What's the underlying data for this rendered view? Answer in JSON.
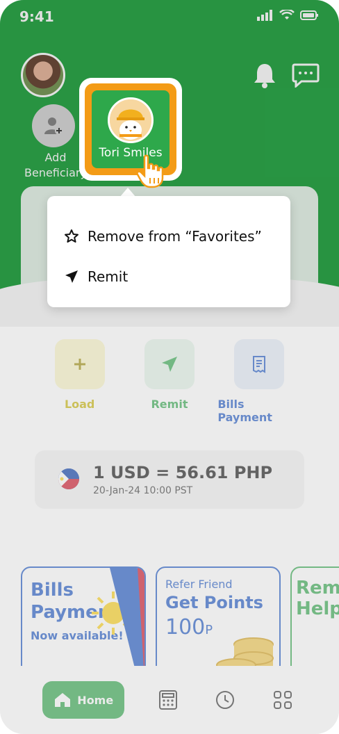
{
  "status": {
    "time": "9:41"
  },
  "header": {
    "add_beneficiary_label": "Add Beneficiary",
    "favorite_name": "Tori Smiles"
  },
  "context_menu": {
    "remove_favorite": "Remove from “Favorites”",
    "remit": "Remit"
  },
  "services": [
    {
      "label": "Load",
      "color": "#c9b400"
    },
    {
      "label": "Remit",
      "color": "#2ea84b"
    },
    {
      "label": "Bills Payment",
      "color": "#1a56c4"
    }
  ],
  "exchange_rate": {
    "main": "1 USD = 56.61 PHP",
    "timestamp": "20-Jan-24 10:00 PST"
  },
  "banners": {
    "bills": {
      "line1": "Bills",
      "line2": "Payment",
      "line3": "Now available!"
    },
    "refer": {
      "line1": "Refer Friend",
      "line2": "Get Points",
      "line3": "100",
      "unit": "P"
    },
    "remit": {
      "line1": "Rem",
      "line2": "Help"
    }
  },
  "bottom_nav": {
    "home_label": "Home"
  },
  "colors": {
    "primary": "#2ea84b",
    "accent": "#f39b16",
    "blue": "#1a56c4"
  }
}
